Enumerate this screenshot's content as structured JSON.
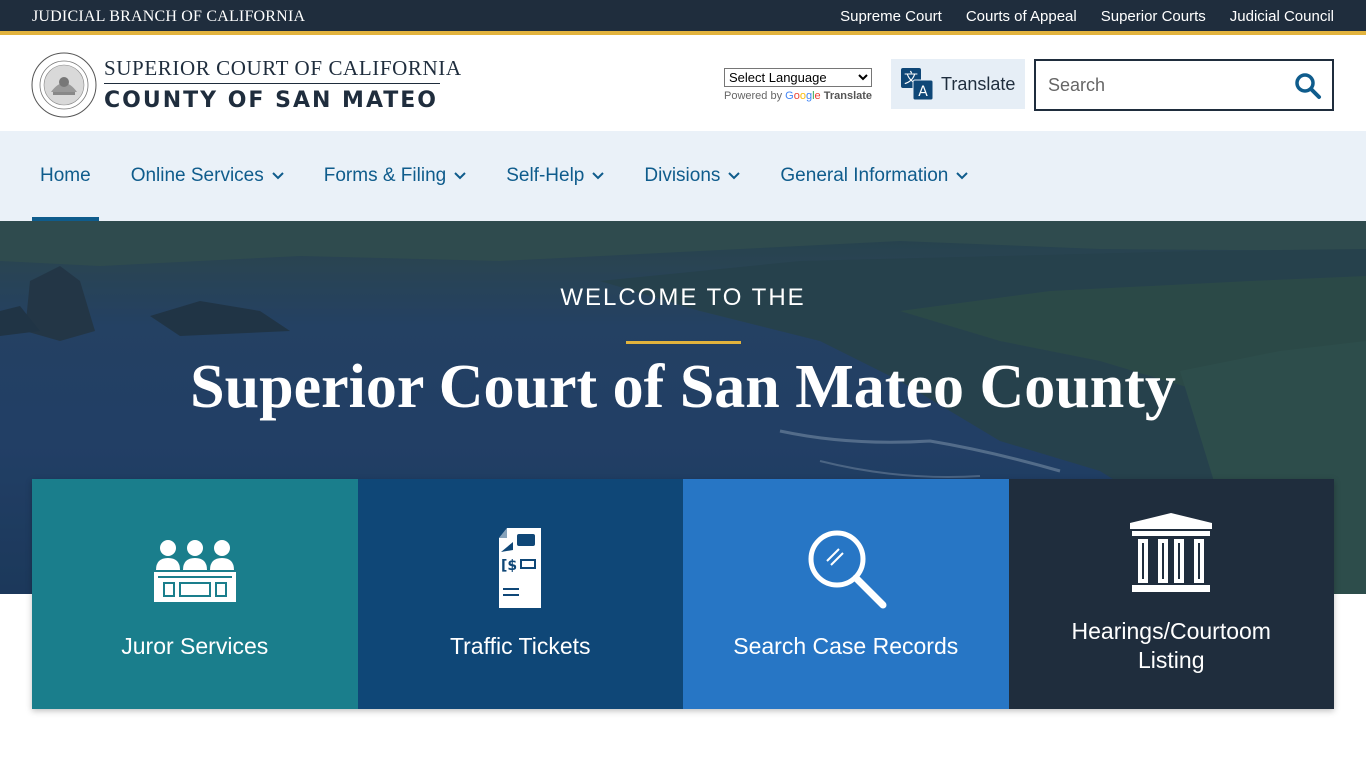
{
  "topbar": {
    "branch": "JUDICIAL BRANCH OF CALIFORNIA",
    "links": [
      "Supreme Court",
      "Courts of Appeal",
      "Superior Courts",
      "Judicial Council"
    ]
  },
  "header": {
    "title_line1": "SUPERIOR COURT OF CALIFORNIA",
    "title_line2": "COUNTY OF SAN MATEO",
    "language_select": "Select Language",
    "powered_by": "Powered by",
    "powered_google": "Google",
    "powered_translate": "Translate",
    "translate_label": "Translate",
    "search_placeholder": "Search"
  },
  "nav": {
    "items": [
      {
        "label": "Home"
      },
      {
        "label": "Online Services"
      },
      {
        "label": "Forms & Filing"
      },
      {
        "label": "Self-Help"
      },
      {
        "label": "Divisions"
      },
      {
        "label": "General Information"
      }
    ]
  },
  "hero": {
    "welcome": "WELCOME TO THE",
    "title": "Superior Court of San Mateo County"
  },
  "tiles": [
    {
      "label": "Juror Services",
      "color": "#1a7e8c",
      "icon": "jurors-icon"
    },
    {
      "label": "Traffic Tickets",
      "color": "#0f4777",
      "icon": "traffic-ticket-icon"
    },
    {
      "label": "Search Case Records",
      "color": "#2776c5",
      "icon": "magnifier-icon"
    },
    {
      "label": "Hearings/Courtoom Listing",
      "color": "#1f2d3d",
      "icon": "courthouse-icon"
    }
  ],
  "colors": {
    "navy": "#1f2d3d",
    "gold": "#e2b33d",
    "nav_bg": "#eaf1f8",
    "link_blue": "#0f5c8c"
  }
}
